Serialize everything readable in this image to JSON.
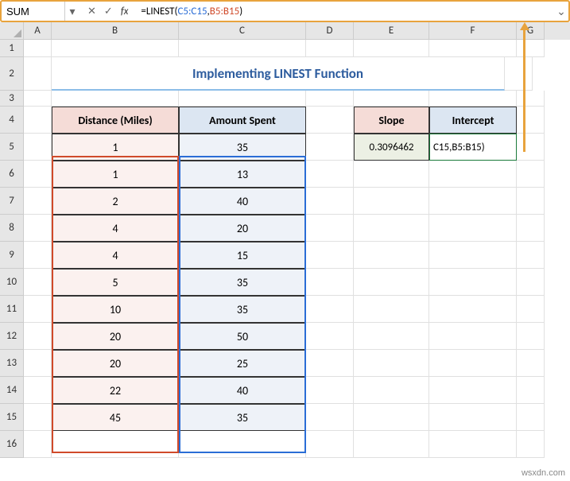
{
  "name_box": "SUM",
  "formula": {
    "raw": "=LINEST(C5:C15,B5:B15)",
    "eq": "=",
    "fn": "LINEST",
    "r1": "C5:C15",
    "r2": "B5:B15"
  },
  "columns": [
    "A",
    "B",
    "C",
    "D",
    "E",
    "F",
    "G"
  ],
  "rows": [
    "1",
    "2",
    "3",
    "4",
    "5",
    "6",
    "7",
    "8",
    "9",
    "10",
    "11",
    "12",
    "13",
    "14",
    "15",
    "16"
  ],
  "title": "Implementing LINEST Function",
  "headers": {
    "distance": "Distance (Miles)",
    "amount": "Amount Spent",
    "slope": "Slope",
    "intercept": "Intercept"
  },
  "data": {
    "distance": [
      1,
      1,
      2,
      4,
      4,
      5,
      10,
      20,
      20,
      22,
      45
    ],
    "amount": [
      35,
      13,
      40,
      20,
      15,
      35,
      35,
      50,
      25,
      40,
      35
    ]
  },
  "results": {
    "slope": "0.3096462",
    "intercept_display": "C15,B5:B15)"
  },
  "watermark": "wsxdn.com",
  "chart_data": {
    "type": "table",
    "title": "Implementing LINEST Function",
    "columns": [
      "Distance (Miles)",
      "Amount Spent"
    ],
    "rows": [
      [
        1,
        35
      ],
      [
        1,
        13
      ],
      [
        2,
        40
      ],
      [
        4,
        20
      ],
      [
        4,
        15
      ],
      [
        5,
        35
      ],
      [
        10,
        35
      ],
      [
        20,
        50
      ],
      [
        20,
        25
      ],
      [
        22,
        40
      ],
      [
        45,
        35
      ]
    ],
    "derived": {
      "slope": 0.3096462
    }
  }
}
